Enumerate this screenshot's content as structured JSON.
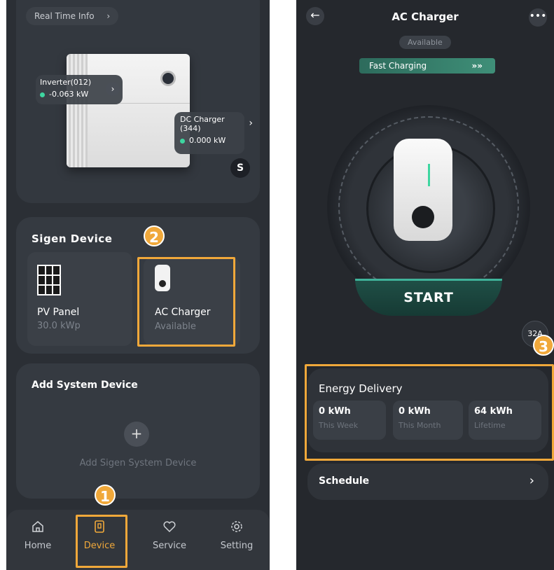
{
  "left": {
    "real_time_info": "Real Time Info",
    "inverter": {
      "name": "Inverter(012)",
      "value": "-0.063 kW"
    },
    "dc_charger": {
      "name": "DC Charger",
      "id": "(344)",
      "value": "0.000 kW"
    },
    "sigen_device": {
      "title": "Sigen Device",
      "devices": [
        {
          "name": "PV Panel",
          "detail": "30.0 kWp"
        },
        {
          "name": "AC Charger",
          "detail": "Available"
        }
      ]
    },
    "add_system": {
      "title": "Add System Device",
      "button_label": "Add Sigen System Device"
    },
    "nav": [
      {
        "label": "Home",
        "icon": "home-icon"
      },
      {
        "label": "Device",
        "icon": "device-icon"
      },
      {
        "label": "Service",
        "icon": "service-icon"
      },
      {
        "label": "Setting",
        "icon": "gear-icon"
      }
    ]
  },
  "right": {
    "title": "AC Charger",
    "status": "Available",
    "fast_charging": "Fast Charging",
    "start_label": "START",
    "current": "32A",
    "energy": {
      "title": "Energy Delivery",
      "stats": [
        {
          "value": "0 kWh",
          "label": "This Week"
        },
        {
          "value": "0 kWh",
          "label": "This Month"
        },
        {
          "value": "64 kWh",
          "label": "Lifetime"
        }
      ]
    },
    "schedule": "Schedule"
  },
  "badges": [
    "1",
    "2",
    "3"
  ],
  "colors": {
    "accent": "#f0a83a",
    "green": "#3ed6a0",
    "teal": "#2e8c72",
    "card": "#353a41"
  }
}
